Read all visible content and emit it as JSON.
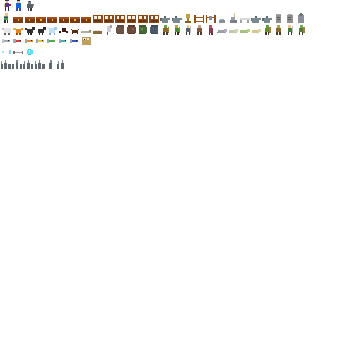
{
  "sheet": {
    "background": "#ffffff",
    "rows": [
      {
        "name": "characters",
        "sprites": [
          "hero-mage-sprite",
          "villager-blue-sprite",
          "knight-gray-sprite"
        ]
      },
      {
        "name": "props-and-furniture",
        "sprites": [
          "hero-small-sprite",
          "chest-sprite",
          "chest-sprite",
          "chest-sprite",
          "chest-sprite",
          "chest-sprite",
          "chest-sprite",
          "chest-sprite",
          "cabinet-sprite",
          "cabinet-sprite",
          "cabinet-sprite",
          "cabinet-sprite",
          "cabinet-sprite",
          "cabinet-sprite",
          "teapot-sprite",
          "teapot-sprite",
          "trophy-sprite",
          "fence-sprite",
          "fence-sprite",
          "stone-sprite",
          "statue-sprite",
          "bench-sprite",
          "teapot-sprite",
          "teapot-sprite",
          "tombstone-sprite",
          "tombstone-sprite",
          "tombstone-sprite"
        ]
      },
      {
        "name": "creatures",
        "sprites": [
          "sheep-sprite",
          "fox-sprite",
          "dog-sprite",
          "dog-sprite",
          "ice-wolf-sprite",
          "spider-sprite",
          "crab-sprite",
          "worm-sprite",
          "nest-sprite",
          "bird-sprite",
          "boulder-sprite",
          "boulder-sprite",
          "bush-sprite",
          "boulder-sprite",
          "goblin-sprite",
          "goblin-sprite",
          "soldier-sprite",
          "soldier-sprite",
          "rat-sprite",
          "rat-sprite",
          "slug-sprite",
          "slug-sprite",
          "slug-sprite",
          "goblin-sprite",
          "goblin-sprite",
          "soldier-sprite",
          "goblin-sprite"
        ]
      },
      {
        "name": "fish-and-items",
        "sprites": [
          "fish-gray-sprite",
          "fish-red-sprite",
          "fish-orange-sprite",
          "fish-yellow-sprite",
          "fish-green-sprite",
          "fish-teal-sprite",
          "fish-blue-sprite",
          "owl-sprite"
        ]
      },
      {
        "name": "projectiles",
        "sprites": [
          "arrow-cyan-sprite",
          "bone-sprite",
          "gem-cyan-sprite"
        ]
      },
      {
        "name": "terrain",
        "sprites": [
          "spikes-sprite",
          "spikes-sprite",
          "spikes-sprite",
          "spikes-sprite",
          "spike-single-sprite",
          "spikes-sprite"
        ]
      }
    ]
  }
}
